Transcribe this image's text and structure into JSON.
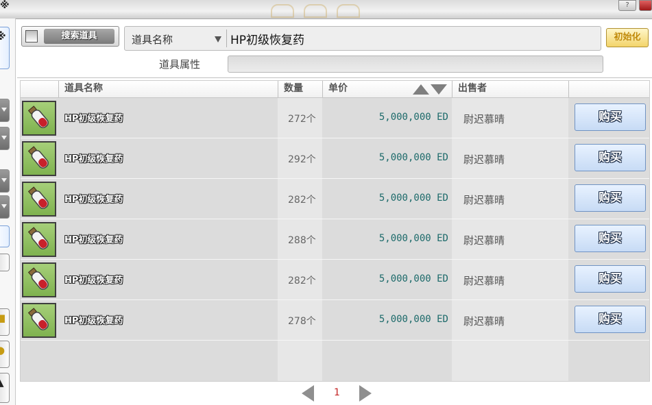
{
  "window": {
    "corner_glyph": "※",
    "help_label": "?"
  },
  "search": {
    "button_label": "搜索道具",
    "category_label": "道具名称",
    "query": "HP初级恢复药",
    "reset_label": "初始化",
    "attr_label": "道具属性",
    "attr_value": ""
  },
  "table": {
    "headers": [
      "道具名称",
      "数量",
      "单价",
      "出售者"
    ],
    "rows": [
      {
        "name": "HP初级恢复药",
        "qty": "272个",
        "price": "5,000,000 ED",
        "seller": "尉迟慕晴",
        "buy": "购买"
      },
      {
        "name": "HP初级恢复药",
        "qty": "292个",
        "price": "5,000,000 ED",
        "seller": "尉迟慕晴",
        "buy": "购买"
      },
      {
        "name": "HP初级恢复药",
        "qty": "282个",
        "price": "5,000,000 ED",
        "seller": "尉迟慕晴",
        "buy": "购买"
      },
      {
        "name": "HP初级恢复药",
        "qty": "288个",
        "price": "5,000,000 ED",
        "seller": "尉迟慕晴",
        "buy": "购买"
      },
      {
        "name": "HP初级恢复药",
        "qty": "282个",
        "price": "5,000,000 ED",
        "seller": "尉迟慕晴",
        "buy": "购买"
      },
      {
        "name": "HP初级恢复药",
        "qty": "278个",
        "price": "5,000,000 ED",
        "seller": "尉迟慕晴",
        "buy": "购买"
      }
    ]
  },
  "pager": {
    "current_page": "1"
  },
  "colors": {
    "accent_gold": "#c08800",
    "price_teal": "#1c6a6a",
    "page_red": "#c32222",
    "buy_blue": "#c7dbf5"
  },
  "icons": [
    "checkbox-icon",
    "dropdown-arrow-icon",
    "sort-asc-icon",
    "sort-desc-icon",
    "potion-icon",
    "prev-page-icon",
    "next-page-icon",
    "close-icon",
    "help-icon"
  ]
}
